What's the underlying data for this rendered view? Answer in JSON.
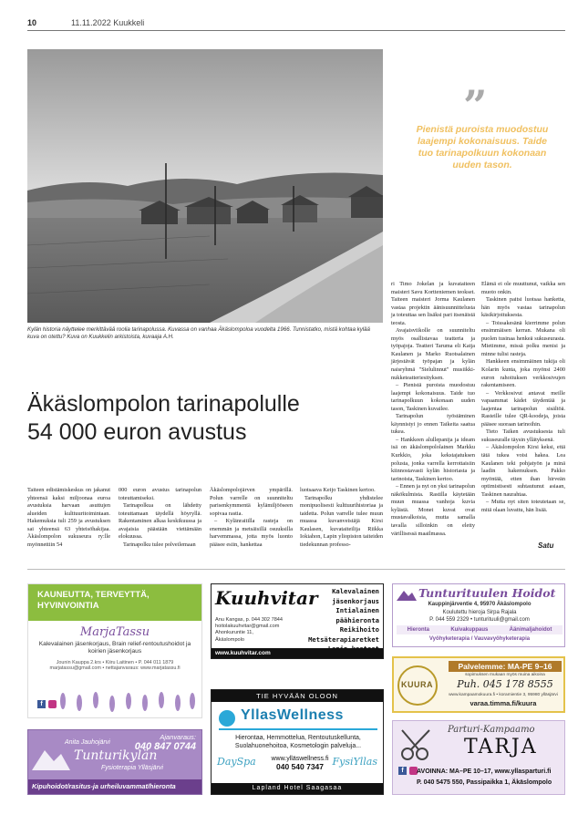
{
  "header": {
    "page_number": "10",
    "date_section": "11.11.2022 Kuukkeli"
  },
  "photo": {
    "caption": "Kylän historia näyttelee merkittävää roolia tarinapolussa. Kuvassa on vanhaa Äkäslompoloa vuodelta 1966. Tunnistatko, mistä kohtaa kylää kuva on otettu? Kuva on Kuukkelin arkistoista, kuvaaja A.H."
  },
  "pull_quote": {
    "mark": "”",
    "text": "Pienistä puroista muodostuu laajempi kokonaisuus. Taide tuo tarinapolkuun kokonaan uuden tason."
  },
  "article": {
    "headline_line1": "Äkäslompolon tarinapolulle",
    "headline_line2": "54 000 euron avustus",
    "signature": "Satu",
    "col1": "Taiteen edistämiskeskus on jakanut yhteensä kaksi miljoonaa euroa avustuksia harvaan asuttujen alueiden kulttuuritoimintaan. Hakemuksia tuli 259 ja avustuksen sai yhteensä 63 yhteisöhakijaa. Äkäslompolon sukuseura ry:lle myönnettiin 54",
    "col2": "000 euron avustus tarinapolun toteuttamiseksi.",
    "col2_p2": "Tarinapolkua on lähdetty toteuttamaan täydellä höyryllä. Rakentaminen alkaa keskikuussa ja avajaisia päästään viettämään elokuussa.",
    "col2_p3": "Tarinapolku tulee polveilemaan",
    "col3": "Äkäslompolojärven ympärillä. Polun varrelle on suunniteltu parisenkymmentä kylämiljööseen sopivaa rastia.",
    "col3_p2": "– Kylänraitilla rasteja on enemmän ja metsäisillä osuuksilla harvemmassa, jotta myös luonto pääsee esiin, hankettaa",
    "col4": "luotsaava Keijo Taskinen kertoo.",
    "col4_p2": "Tarinapolku yhdistelee monipuolisesti kulttuurihistoriaa ja taidetta. Polun varrelle tulee muun muassa kuvanveistäjä Kirsi Kaulasen, kuvataiteilija Riikka Iokiahon, Lapin yliopiston taiteiden tiedekunnan professo-",
    "col5": "ri Timo Jokelan ja kuvataiteen maisteri Savu Kortteniemen teokset. Taiteen maisteri Jorma Kaulanen vastaa projektin äänisuunnittelusta ja toteuttaa sen lisäksi pari itsenäistä teosta.",
    "col5_p2": "Avajaisviikolle on suunniteltu myös osallistavaa teatteria ja työpajoja. Teatteri Taruma eli Katja Kaulanen ja Marko Ruotsalainen järjestävät työpajan ja kylän naisryhmä \"Sielulinnut\" musiikki-nukketeatteriesityksen.",
    "col5_p3": "– Pienistä puroista muodostuu laajempi kokonaisuus. Taide tuo tarinapolkuun kokonaan uuden tason, Taskinen kuvailee.",
    "col5_p4": "Tarinapolun työstäminen käynnistyi jo ennen Taikeita saatua tukea.",
    "col5_p5": "– Hankkeen alullepanija ja ideam isä on äkäslompololainen Markku Kurkkio, joka kekstajatuksen polusta, jonka varrella kerrottaisiin kiinnostavasti kylän historiasta ja tarinoista, Taskinen kertoo.",
    "col5_p6": "– Ennen ja nyt on yksi tarinapolun näkökulmista. Rastilla käytetään muun muassa vanhoja kuvia kylästä. Monet kuvat ovat mustavalkoisia, mutta samalla tavalla silloinkin on eletty värillisessä maailmassa.",
    "col6": "Elämä ei ole muuttunut, vaikka sen muoto onkin.",
    "col6_p2": "Taskinen paitsi luotsaa hanketta, hän myös vastaa tarinapolun käsikirjoituksesta.",
    "col6_p3": "– Toissakesänä kierrimme polun ensimmäisen kerran. Mukana oli puolen tusinaa henkeä sukuseurasta. Mietimme, missä polku menisi ja minne tulisi rasteja.",
    "col6_p4": "Hankkeen ensimmäinen tukija oli Kolarin kunta, joka myönsi 2400 euron rahoituksen verkkosivujen rakentamiseen.",
    "col6_p5": "– Verkkosivut antavat meille vapaammat kädet täydentää ja laajentaa tarinapolun sisältöä. Rasteille tulee QR-koodeja, joista pääsee suoraan tarinoihin.",
    "col6_p6": "Tieto Taiken avustuksesta tuli sukuseuralle täysin yllätyksenä.",
    "col6_p7": "– Äkäslompolon Kirsi keksi, että tätä tukea voisi hakea. Lea Kaulanen teki pohjatyön ja minä laadin hakemuksen. Pakko myöntää, etten ihan hirveän optimistisesti suhtautunut asiaan, Taskinen naurahtaa.",
    "col6_p8": "– Mutta nyt siten toteutetaan se, mitä olaan luvattu, hän lisää."
  },
  "ads": {
    "marja": {
      "banner": "KAUNEUTTA, TERVEYTTÄ, HYVINVOINTIA",
      "name": "MarjaTassu",
      "line1": "Kalevalainen jäsenkorjaus, Brain relief-rentoutushoidot ja koirien jäsenkorjaus",
      "line2": "Jounin Kauppa 2.krs • Kiiru Laitinen • P. 044 011 1879",
      "line3": "marjatassu@gmail.com • nettajanvaraus: www.marjatassu.fi"
    },
    "tunturikyla": {
      "booking": "Ajanvaraus:",
      "phone": "040 847 0744",
      "person": "Anita Jauhojärvi",
      "name": "Tunturikylän",
      "sub": "Fysioterapia Ylläsjärvi",
      "footer": "Kipuhoidot/rasitus-ja urheiluvammat/hieronta"
    },
    "kuuhvitar": {
      "logo": "Kuuhvitar",
      "services": [
        "Kalevalainen jäsenkorjaus",
        "Intialainen päähieronta",
        "Reikihoito",
        "Metsäterapiaretket",
        "Lapin kasteet"
      ],
      "contact1": "Anu Kangas, p. 044 302 7844",
      "contact2": "hoitolakuuhvitar@gmail.com",
      "contact3": "Ahonkuruntie 11,",
      "contact4": "Äkäslompolo",
      "url": "www.kuuhvitar.com"
    },
    "yllaswellness": {
      "top": "TIE HYVÄÄN OLOON",
      "name": "YllasWellness",
      "services": "Hierontaa, Hemmottelua, Rentoutuskellunta, Suolahuonehoitoa, Kosmetologin palveluja...",
      "url": "www.ylläswellness.fi",
      "phone": "040 540 7347",
      "brand1": "DaySpa",
      "brand2": "FysiYllas",
      "footer": "Lapland Hotel Saagasaa"
    },
    "tunturiluuten": {
      "name": "Tunturituulen Hoidot",
      "address": "Kauppinjärventie 4, 95970 Äkäslompolo",
      "line2": "Koulutettu hieroja Sirpa Rajala",
      "line3": "P. 044 559 2329 • tunturituuli@gmail.com",
      "services": [
        "Hieronta",
        "Kuivakuppaus",
        "Äänimaljahoidot"
      ],
      "services2": "Vyöhyketerapia / Vauvavyöhyketerapia"
    },
    "kuura": {
      "logo": "KUURA",
      "open": "Palvelemme: MA-PE 9–16",
      "note": "sopimuksen mukaan myös muina aikoina",
      "phone": "Puh. 045 178 8555",
      "address": "www.kampaamokuura.fi • koramientie 3, 95980 ylläsjärvi",
      "booking": "varaa.timma.fi/kuura"
    },
    "tarja": {
      "small": "Parturi-Kampaamo",
      "name": "TARJA",
      "hours": "AVOINNA: MA–PE 10–17, www.yllasparturi.fi",
      "contact": "P. 040 5475 550, Passipaikka 1, Äkäslompolo"
    }
  },
  "colors": {
    "purple": "#6b3f8c",
    "quote_gold": "#f0c060",
    "green": "#8cbd3f",
    "lavender": "#a88ac5"
  }
}
